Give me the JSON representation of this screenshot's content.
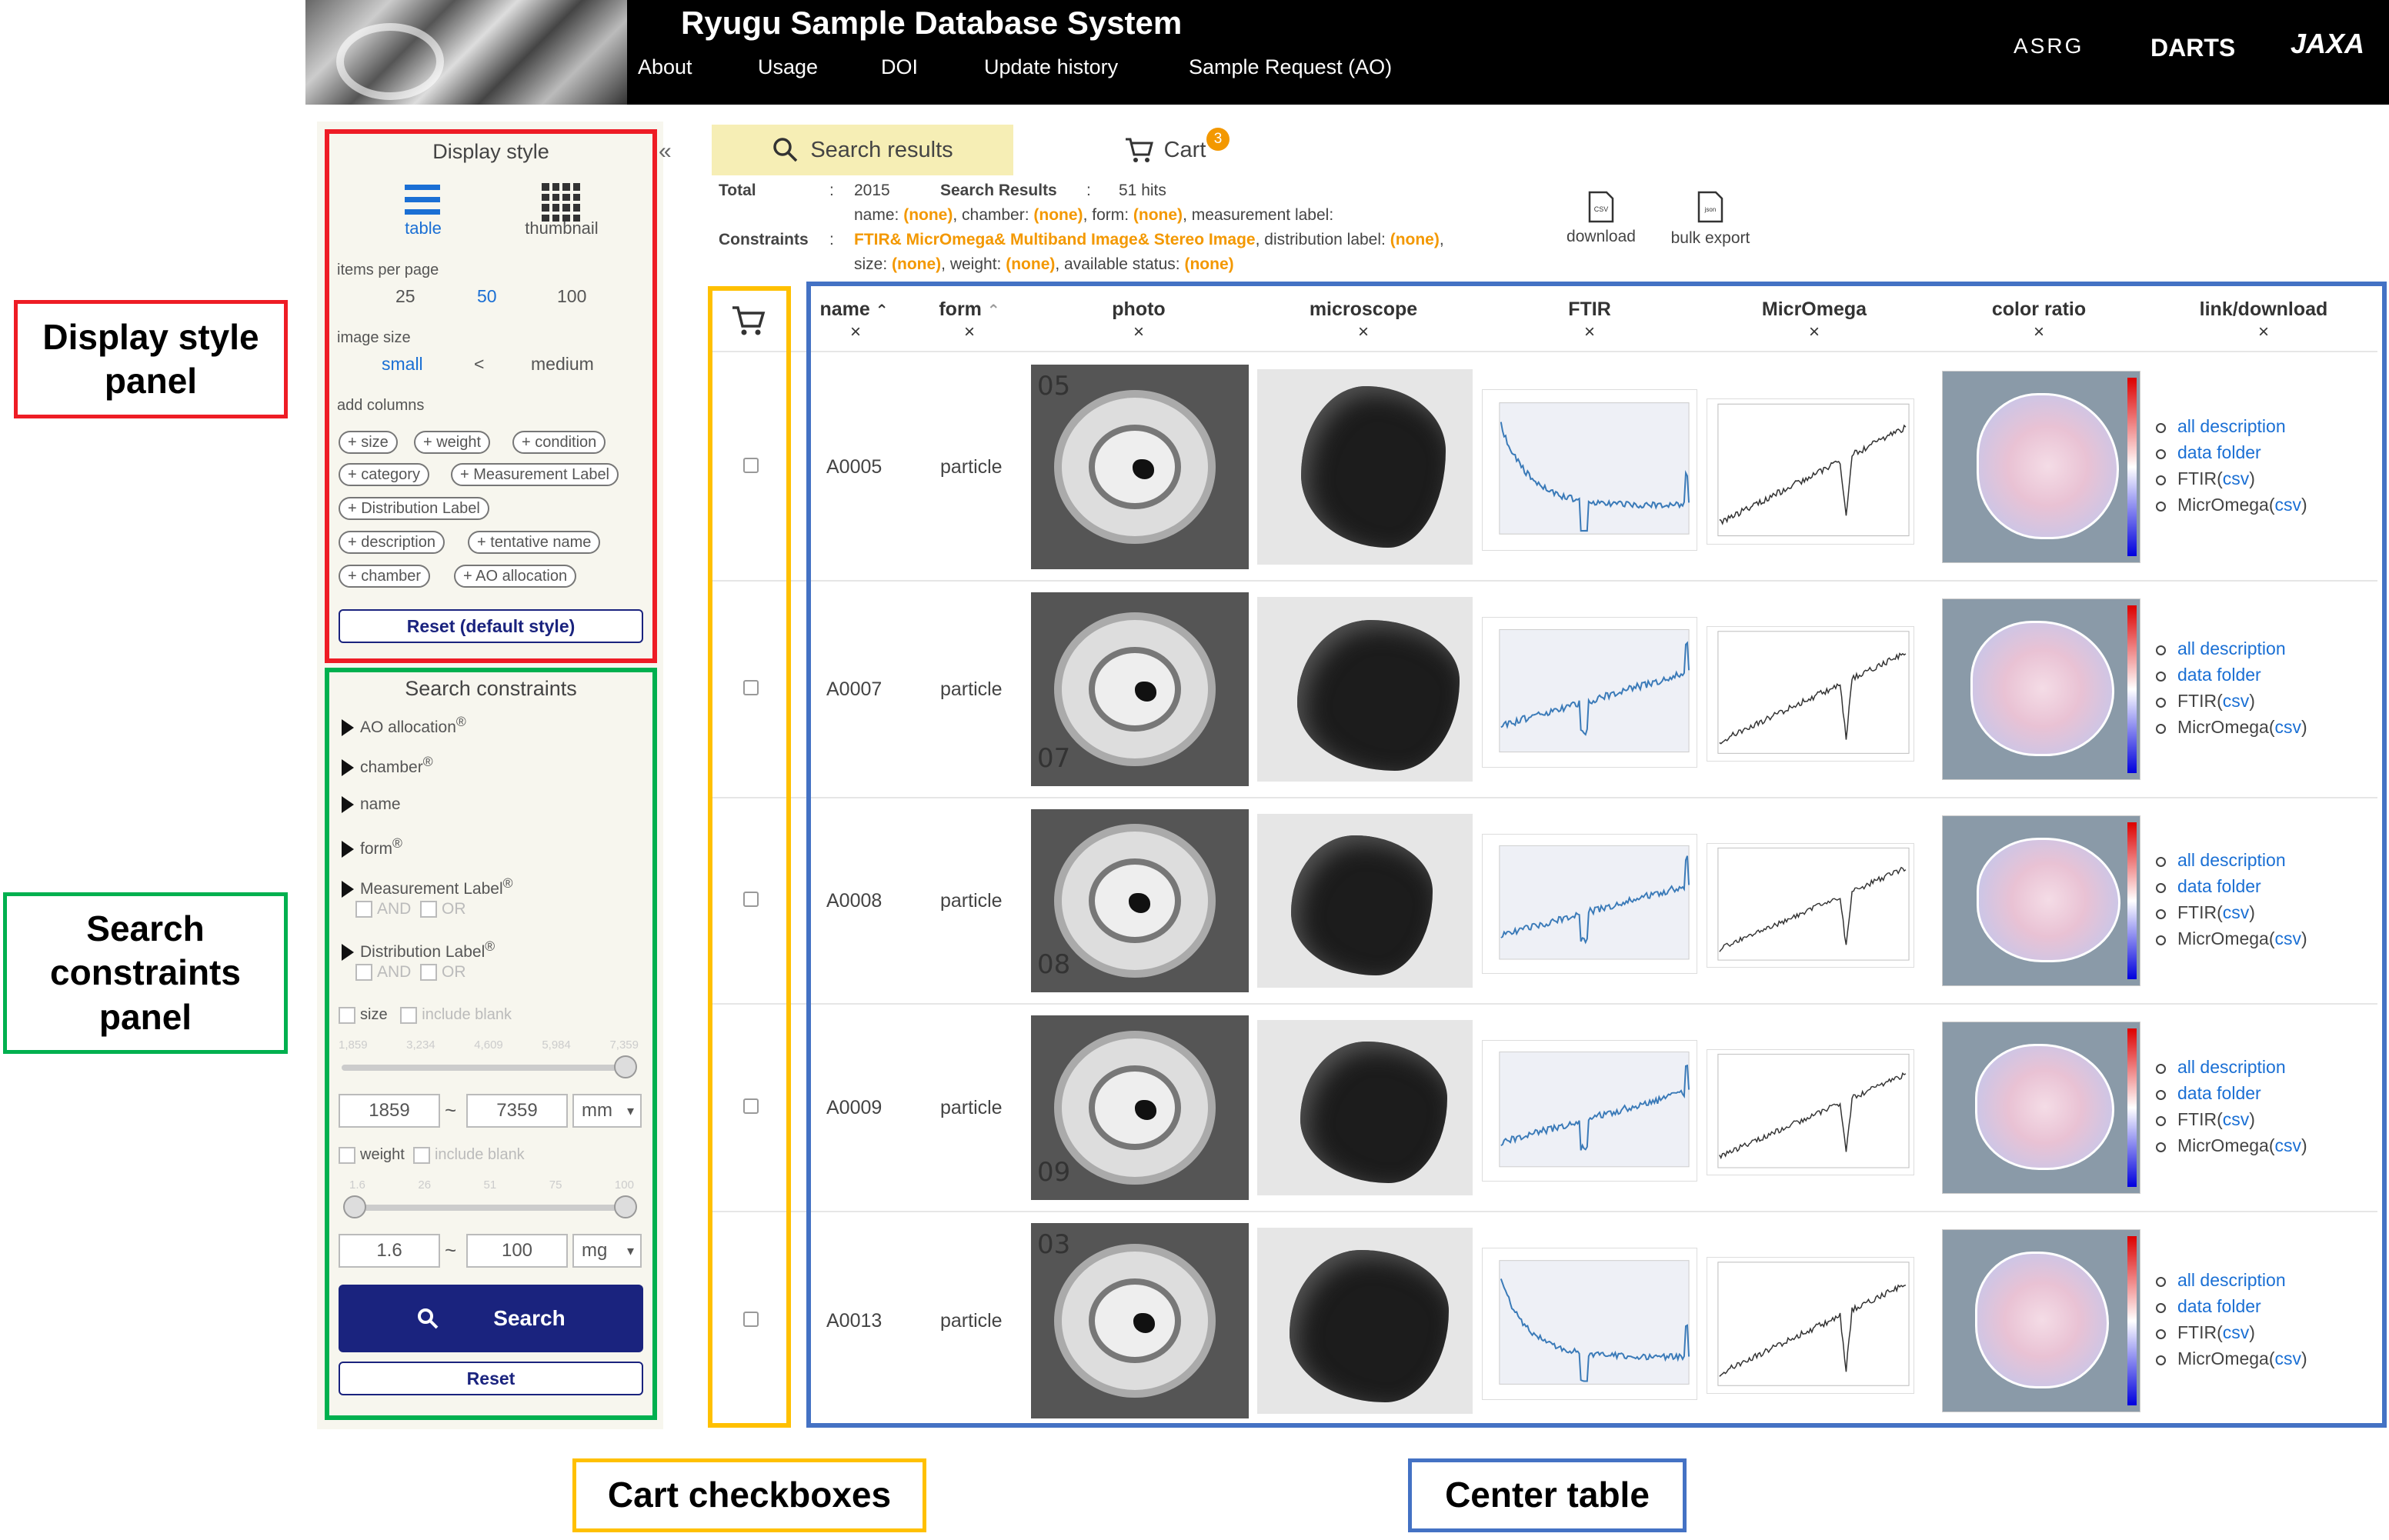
{
  "header": {
    "title": "Ryugu Sample Database System",
    "nav": [
      "About",
      "Usage",
      "DOI",
      "Update history",
      "Sample Request (AO)"
    ],
    "logos": [
      "ASRG",
      "DARTS",
      "JAXA"
    ]
  },
  "annotations": {
    "display_style_panel": "Display style panel",
    "search_constraints_panel": "Search constraints panel",
    "cart_checkboxes": "Cart checkboxes",
    "center_table": "Center table"
  },
  "display_style": {
    "title": "Display style",
    "table_label": "table",
    "thumbnail_label": "thumbnail",
    "items_per_page_label": "items per page",
    "items_per_page_options": [
      "25",
      "50",
      "100"
    ],
    "image_size_label": "image size",
    "image_size_small": "small",
    "image_size_sep": "<",
    "image_size_medium": "medium",
    "add_columns_label": "add columns",
    "chips": [
      "+ size",
      "+ weight",
      "+ condition",
      "+ category",
      "+ Measurement Label",
      "+ Distribution Label",
      "+ description",
      "+ tentative name",
      "+ chamber",
      "+ AO allocation"
    ],
    "reset_label": "Reset (default style)",
    "collapse_glyph": "«"
  },
  "search_constraints": {
    "title": "Search constraints",
    "items": [
      "AO allocation",
      "chamber",
      "name",
      "form",
      "Measurement Label",
      "Distribution Label"
    ],
    "and_label": "AND",
    "or_label": "OR",
    "size_label": "size",
    "include_blank": "include blank",
    "size_ticks": [
      "1,859",
      "3,234",
      "4,609",
      "5,984",
      "7,359"
    ],
    "size_min": "1859",
    "size_max": "7359",
    "size_unit": "mm",
    "tilde": "~",
    "weight_label": "weight",
    "weight_ticks": [
      "1.6",
      "26",
      "51",
      "75",
      "100"
    ],
    "weight_min": "1.6",
    "weight_max": "100",
    "weight_unit": "mg",
    "search_button": "Search",
    "reset_button": "Reset"
  },
  "tabs": {
    "search_results": "Search results",
    "cart": "Cart",
    "cart_count": "3"
  },
  "summary": {
    "total_label": "Total",
    "colon": ":",
    "total_value": "2015",
    "search_results_label": "Search Results",
    "hits": "51 hits",
    "constraints_label": "Constraints",
    "line1_parts": [
      "name: ",
      "(none)",
      ", chamber: ",
      "(none)",
      ", form: ",
      "(none)",
      ", measurement label:"
    ],
    "line2_parts": [
      "FTIR& MicrOmega& Multiband Image& Stereo Image",
      ", distribution label: ",
      "(none)",
      ","
    ],
    "line3_parts": [
      "size: ",
      "(none)",
      ", weight: ",
      "(none)",
      ", available status: ",
      "(none)"
    ],
    "download_label": "download",
    "bulk_export_label": "bulk export"
  },
  "table": {
    "columns": [
      "name",
      "form",
      "photo",
      "microscope",
      "FTIR",
      "MicrOmega",
      "color ratio",
      "link/download"
    ],
    "remove_glyph": "×",
    "rows": [
      {
        "name": "A0005",
        "form": "particle",
        "photo_label": "05"
      },
      {
        "name": "A0007",
        "form": "particle",
        "photo_label": "07"
      },
      {
        "name": "A0008",
        "form": "particle",
        "photo_label": "08"
      },
      {
        "name": "A0009",
        "form": "particle",
        "photo_label": "09"
      },
      {
        "name": "A0013",
        "form": "particle",
        "photo_label": "03"
      }
    ],
    "links": {
      "all_description": "all description",
      "data_folder": "data folder",
      "ftir": "FTIR(",
      "micromega": "MicrOmega(",
      "csv": "csv",
      "close_paren": ")"
    }
  },
  "colors": {
    "red_box": "#ee1c25",
    "green_box": "#00b04f",
    "yellow_box": "#ffc000",
    "blue_box": "#4472c4",
    "search_button": "#1a237e",
    "orange": "#f39800",
    "link_blue": "#1a6fd4"
  }
}
